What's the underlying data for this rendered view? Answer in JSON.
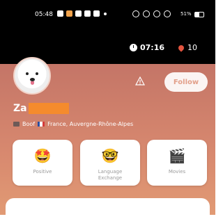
{
  "status_bar": {
    "time": "05:48",
    "battery": "51%"
  },
  "top_bar": {
    "timer": "07:16",
    "count": "10"
  },
  "profile": {
    "name_visible": "Za",
    "job": "Boof",
    "location": "France, Auvergne-Rhône-Alpes",
    "follow_label": "Follow"
  },
  "cards": [
    {
      "emoji": "🤩",
      "label": "Positive"
    },
    {
      "emoji": "🤓",
      "label": "Language\nExchange"
    },
    {
      "emoji": "🎬",
      "label": "Movies"
    }
  ],
  "colors": {
    "header_gradient_top": "#c47567",
    "header_gradient_bottom": "#e19a74",
    "redaction": "#f58b2d",
    "follow_text": "#e2a08a"
  }
}
